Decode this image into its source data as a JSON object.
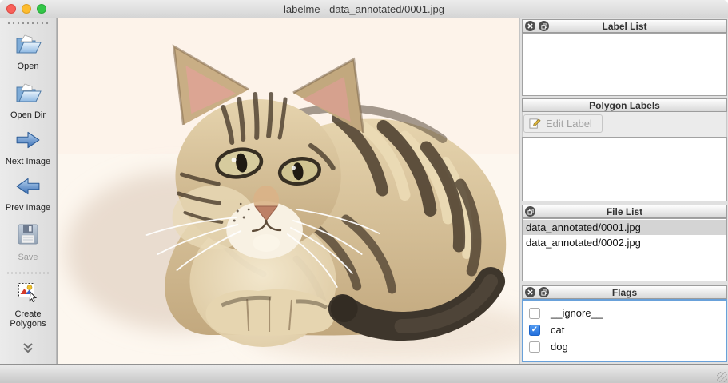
{
  "window": {
    "title": "labelme - data_annotated/0001.jpg"
  },
  "toolbar": {
    "items": [
      {
        "label": "Open",
        "icon": "open-folder-icon",
        "enabled": true
      },
      {
        "label": "Open Dir",
        "icon": "open-folder-icon",
        "enabled": true
      },
      {
        "label": "Next Image",
        "icon": "arrow-right-icon",
        "enabled": true
      },
      {
        "label": "Prev Image",
        "icon": "arrow-left-icon",
        "enabled": true
      },
      {
        "label": "Save",
        "icon": "floppy-disk-icon",
        "enabled": false
      },
      {
        "label": "Create Polygons",
        "icon": "create-polygons-icon",
        "enabled": true
      }
    ]
  },
  "canvas": {
    "image_alt": "tabby kitten lying on a white blanket"
  },
  "panels": {
    "label_list": {
      "title": "Label List"
    },
    "polygon_labels": {
      "title": "Polygon Labels",
      "edit_button_label": "Edit Label"
    },
    "file_list": {
      "title": "File List",
      "files": [
        {
          "name": "data_annotated/0001.jpg",
          "selected": true
        },
        {
          "name": "data_annotated/0002.jpg",
          "selected": false
        }
      ]
    },
    "flags": {
      "title": "Flags",
      "items": [
        {
          "label": "__ignore__",
          "checked": false
        },
        {
          "label": "cat",
          "checked": true
        },
        {
          "label": "dog",
          "checked": false
        }
      ]
    }
  },
  "colors": {
    "flag_checked_blue": "#2f7ce0",
    "focus_ring": "#69a1da",
    "selected_row": "#d4d4d4",
    "canvas_background": "#fdf7ef"
  }
}
